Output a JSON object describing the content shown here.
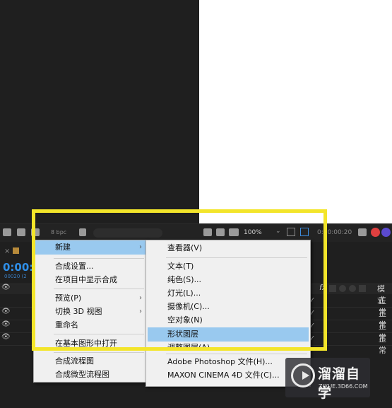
{
  "toolbar": {
    "bpc": "8 bpc",
    "zoom": "100%",
    "time": "0:00:00:20"
  },
  "timeline": {
    "close_glyph": "×",
    "timecode": "0:00:",
    "timecode_sub": "00020 (2",
    "mode_header": "模 式",
    "modes": [
      "正常",
      "正常",
      "正常",
      "正常"
    ],
    "eye_glyph": "👁"
  },
  "context_menu": {
    "items": [
      {
        "label": "新建",
        "has_submenu": true,
        "highlighted": true
      },
      {
        "label": "合成设置..."
      },
      {
        "label": "在项目中显示合成"
      },
      {
        "label": "预览(P)",
        "has_submenu": true
      },
      {
        "label": "切换 3D 视图",
        "has_submenu": true
      },
      {
        "label": "重命名"
      },
      {
        "label": "在基本图形中打开"
      },
      {
        "label": "合成流程图"
      },
      {
        "label": "合成微型流程图"
      }
    ],
    "arrow_glyph": "›"
  },
  "submenu": {
    "items": [
      {
        "label": "查看器(V)"
      },
      {
        "label": "文本(T)"
      },
      {
        "label": "纯色(S)..."
      },
      {
        "label": "灯光(L)..."
      },
      {
        "label": "摄像机(C)..."
      },
      {
        "label": "空对象(N)"
      },
      {
        "label": "形状图层",
        "highlighted": true
      },
      {
        "label": "调整图层(A)"
      },
      {
        "label": "Adobe Photoshop 文件(H)..."
      },
      {
        "label": "MAXON CINEMA 4D 文件(C)..."
      }
    ]
  },
  "watermark": {
    "brand": "溜溜自学",
    "url": "ZIXUE.3D66.COM"
  },
  "colors": {
    "highlight_frame": "#f3e52a",
    "menu_highlight": "#99c9ef",
    "timecode": "#2f8fe8"
  }
}
